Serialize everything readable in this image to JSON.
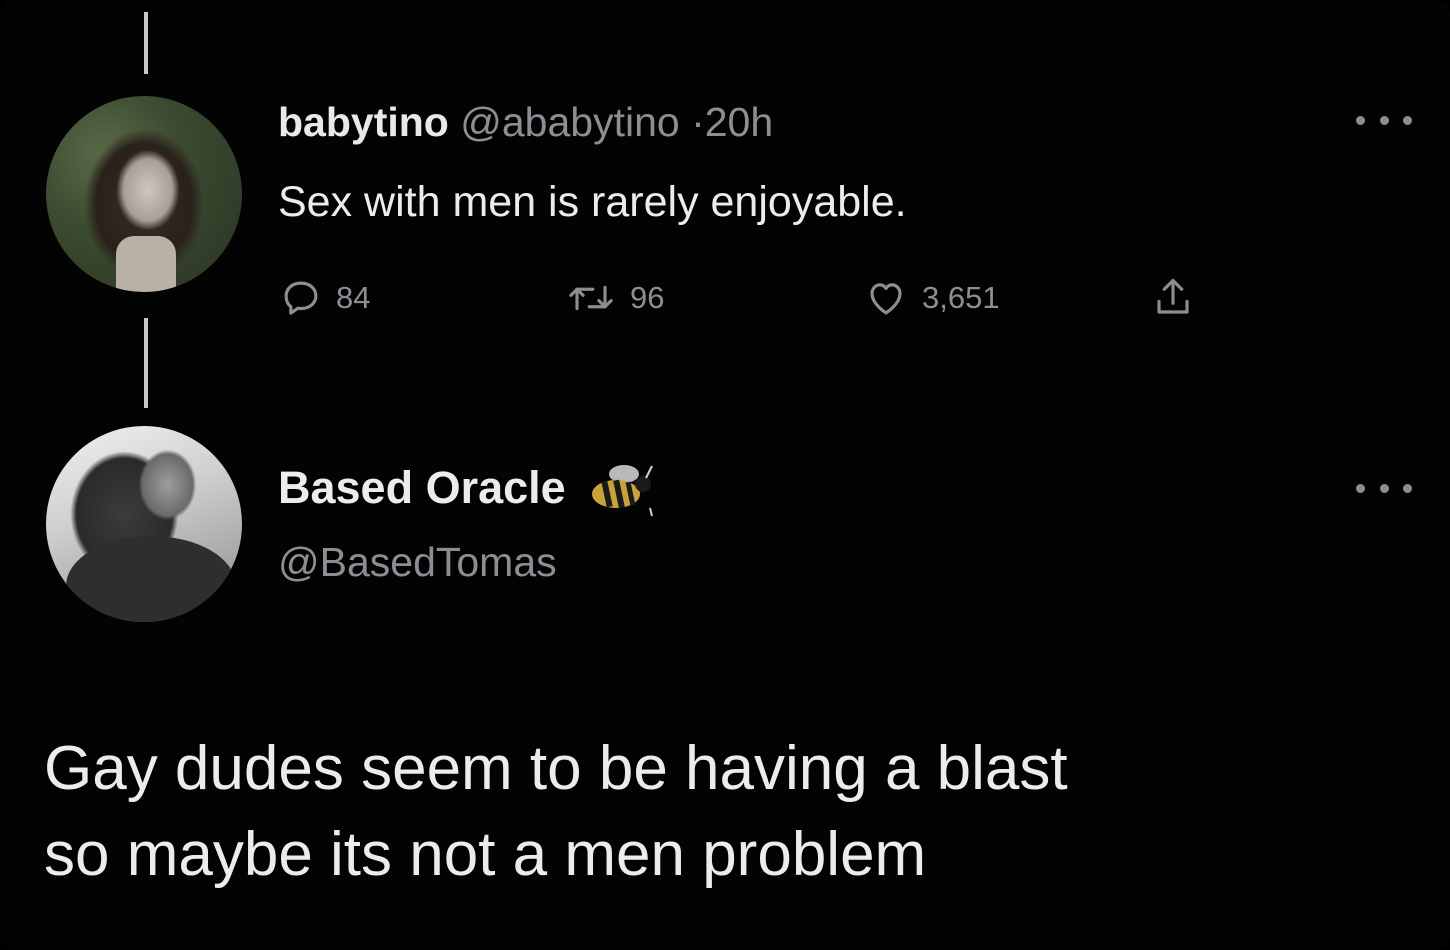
{
  "tweet_1": {
    "display_name": "babytino",
    "handle": "@ababytino",
    "separator": "·",
    "time": "20h",
    "text": "Sex with men is rarely enjoyable.",
    "actions": {
      "replies": "84",
      "retweets": "96",
      "likes": "3,651"
    },
    "icons": [
      "reply-icon",
      "retweet-icon",
      "like-icon",
      "share-icon",
      "more-icon"
    ]
  },
  "tweet_2": {
    "display_name": "Based Oracle",
    "name_emoji": "bee-icon",
    "handle": "@BasedTomas",
    "text_lines": [
      "Gay dudes seem to be having a blast",
      "so maybe its not a men problem"
    ],
    "icons": [
      "more-icon"
    ]
  },
  "colors": {
    "background": "#030303",
    "primary_text": "#ececec",
    "secondary_text": "#8b8f93",
    "thread_line": "#c8c8c8"
  }
}
